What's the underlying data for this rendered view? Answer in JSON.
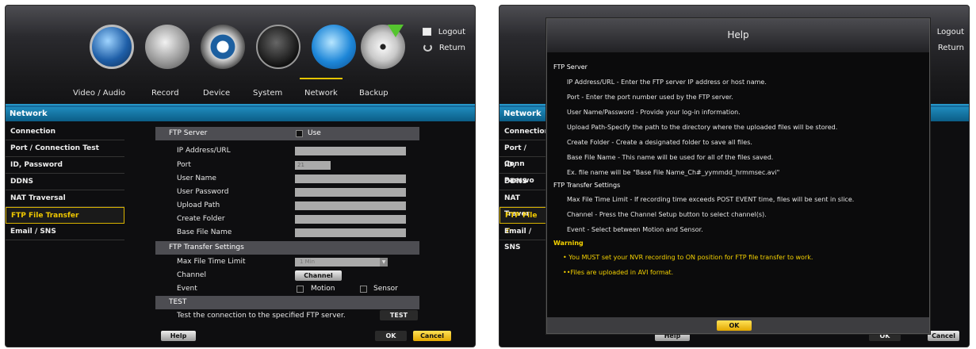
{
  "panel1": {
    "logout": "Logout",
    "return": "Return",
    "menu": [
      "Video / Audio",
      "Record",
      "Device",
      "System",
      "Network",
      "Backup"
    ],
    "section": "Network",
    "sidebar": [
      "Connection",
      "Port / Connection Test",
      "ID, Password",
      "DDNS",
      "NAT Traversal",
      "FTP File Transfer",
      "Email / SNS"
    ],
    "ftp_server": "FTP Server",
    "use": "Use",
    "fields": [
      "IP Address/URL",
      "Port",
      "User Name",
      "User Password",
      "Upload Path",
      "Create Folder",
      "Base File Name"
    ],
    "port_value": "21",
    "transfer_settings": "FTP Transfer Settings",
    "max_time": "Max File Time Limit",
    "max_time_value": "1 Min",
    "channel": "Channel",
    "channel_btn": "Channel Setup",
    "event": "Event",
    "motion": "Motion",
    "sensor": "Sensor",
    "test": "TEST",
    "test_desc": "Test the connection to the specified FTP server.",
    "test_btn": "TEST",
    "help": "Help",
    "ok": "OK",
    "cancel": "Cancel"
  },
  "panel2": {
    "logout": "Logout",
    "return": "Return",
    "section": "Network",
    "sidebar": [
      "Connection",
      "Port / Conn",
      "ID, Passwo",
      "DDNS",
      "NAT Traver",
      "FTP File Tr",
      "Email / SNS"
    ],
    "help_btn": "Help",
    "ok": "OK",
    "cancel": "Cancel",
    "modal": {
      "title": "Help",
      "h1": "FTP Server",
      "lines1": [
        "IP Address/URL - Enter the FTP server IP address or host name.",
        "Port - Enter the port number used by the FTP server.",
        "User Name/Password - Provide your log-in information.",
        "Upload Path-Specify the path to the directory where the uploaded files will be stored.",
        "Create Folder - Create a designated folder to save all files.",
        "Base File Name - This name will be used for all of the files saved.",
        "Ex. file name will be \"Base File Name_Ch#_yymmdd_hrmmsec.avi\""
      ],
      "h2": "FTP Transfer Settings",
      "lines2": [
        "Max File Time Limit - If recording time exceeds POST EVENT time, files will be sent in slice.",
        "Channel - Press the Channel Setup button to select channel(s).",
        "Event - Select between Motion and Sensor."
      ],
      "warning": "Warning",
      "w1": "• You MUST set your NVR recording to ON position for FTP file transfer to work.",
      "w2": "••Files are uploaded in AVI format.",
      "ok": "OK"
    }
  }
}
